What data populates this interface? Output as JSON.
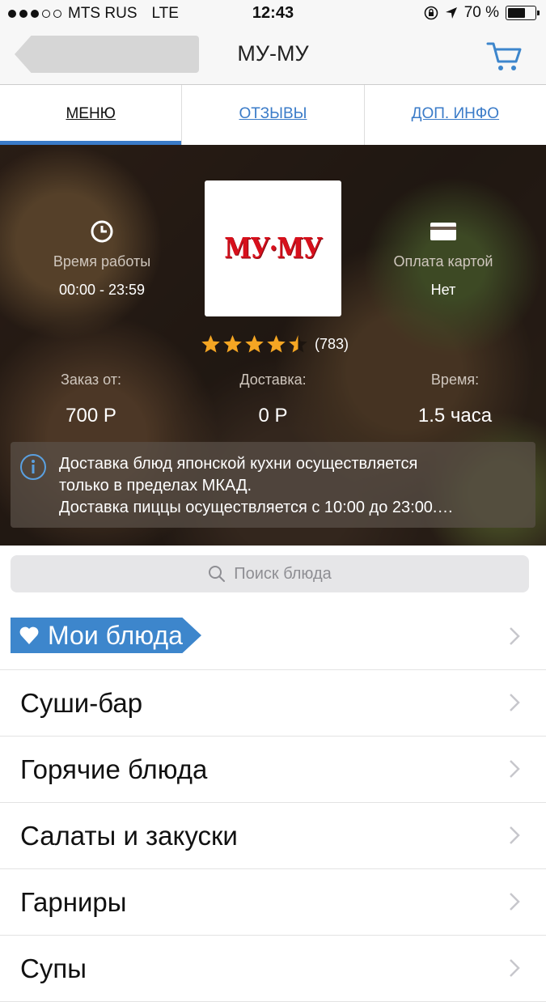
{
  "status": {
    "carrier": "MTS RUS",
    "network": "LTE",
    "time": "12:43",
    "battery": "70 %",
    "battery_level": 0.7,
    "signal_bars_filled": 3,
    "signal_bars_total": 5
  },
  "nav": {
    "title": "МУ-МУ",
    "cart_icon": "cart-icon",
    "back_icon": "back-icon"
  },
  "tabs": [
    {
      "label": "МЕНЮ",
      "active": true
    },
    {
      "label": "ОТЗЫВЫ",
      "active": false
    },
    {
      "label": "ДОП. ИНФО",
      "active": false
    }
  ],
  "restaurant": {
    "logo_text": "МУ·МУ",
    "hours_label": "Время работы",
    "hours_value": "00:00 - 23:59",
    "card_label": "Оплата картой",
    "card_value": "Нет",
    "rating": 4.5,
    "rating_count": "(783)",
    "min_order_label": "Заказ от:",
    "min_order_value": "700 Р",
    "delivery_label": "Доставка:",
    "delivery_value": "0 Р",
    "time_label": "Время:",
    "time_value": "1.5 часа",
    "info_lines": [
      "Доставка блюд японской кухни осуществляется",
      "только в пределах МКАД.",
      "Доставка пиццы осуществляется  с 10:00 до 23:00.…"
    ]
  },
  "search": {
    "placeholder": "Поиск блюда"
  },
  "favorites": {
    "label": "Мои блюда"
  },
  "categories": [
    {
      "label": "Суши-бар"
    },
    {
      "label": "Горячие блюда"
    },
    {
      "label": "Салаты и закуски"
    },
    {
      "label": "Гарниры"
    },
    {
      "label": "Супы"
    }
  ],
  "colors": {
    "accent": "#3d86cc",
    "tab_link": "#3a7bc8",
    "logo_red": "#d7101c",
    "star": "#f5a623"
  }
}
